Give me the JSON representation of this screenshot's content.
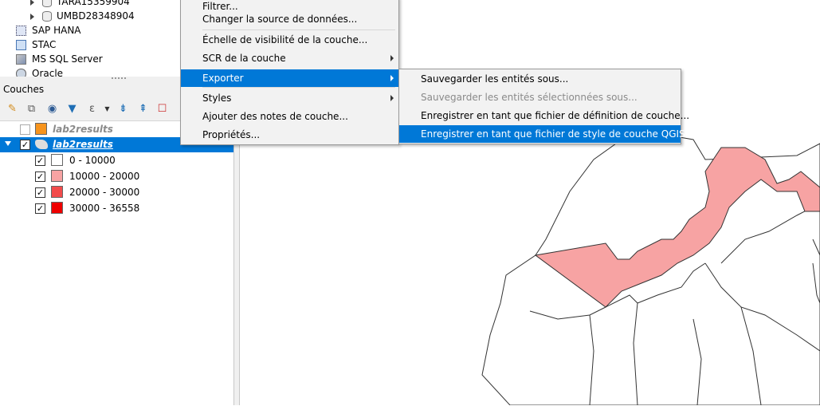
{
  "browser": {
    "items": [
      {
        "label": "TARA15359904"
      },
      {
        "label": "UMBD28348904"
      },
      {
        "label": "SAP HANA"
      },
      {
        "label": "STAC"
      },
      {
        "label": "MS SQL Server"
      },
      {
        "label": "Oracle"
      }
    ]
  },
  "layers_panel": {
    "title": "Couches",
    "layers": [
      {
        "name": "lab2results",
        "color": "#f7941d",
        "checked": false
      },
      {
        "name": "lab2results",
        "checked": true,
        "selected": true
      }
    ],
    "legend": [
      {
        "label": "0 - 10000",
        "color": "#ffffff"
      },
      {
        "label": "10000 - 20000",
        "color": "#f7a3a3"
      },
      {
        "label": "20000 - 30000",
        "color": "#f24b4b"
      },
      {
        "label": "30000 - 36558",
        "color": "#ee0000"
      }
    ]
  },
  "context_menu": {
    "items": [
      {
        "label": "Filtrer..."
      },
      {
        "label": "Changer la source de données..."
      },
      {
        "label": "Échelle de visibilité de la couche..."
      },
      {
        "label": "SCR de la couche"
      },
      {
        "label": "Exporter"
      },
      {
        "label": "Styles"
      },
      {
        "label": "Ajouter des notes de couche..."
      },
      {
        "label": "Propriétés..."
      }
    ]
  },
  "export_submenu": {
    "items": [
      {
        "label": "Sauvegarder les entités sous..."
      },
      {
        "label": "Sauvegarder les entités sélectionnées sous..."
      },
      {
        "label": "Enregistrer en tant que fichier de définition de couche..."
      },
      {
        "label": "Enregistrer en tant que fichier de style de couche QGIS..."
      }
    ]
  },
  "colors": {
    "highlight": "#0078d7",
    "map_feature_fill": "#f7a3a3"
  }
}
